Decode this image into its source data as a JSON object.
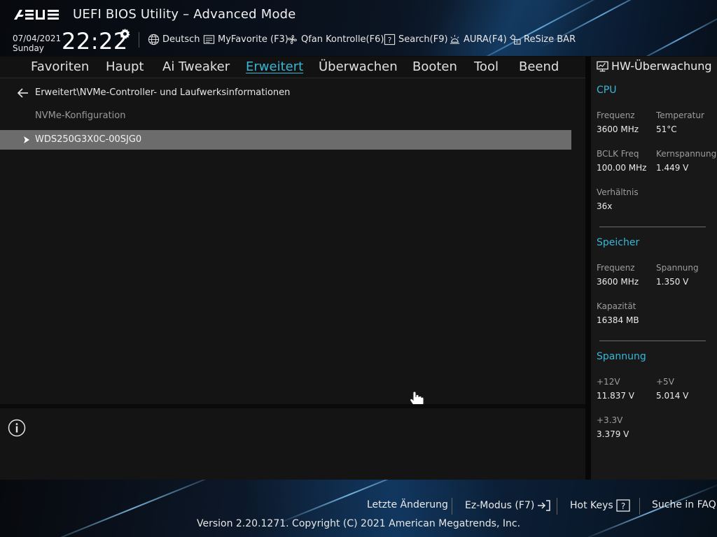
{
  "header": {
    "logo_text": "ASUS",
    "title": "UEFI BIOS Utility – Advanced Mode",
    "date": "07/04/2021",
    "day": "Sunday",
    "time": "22:22",
    "toolbar": [
      {
        "label": "Deutsch",
        "icon": "globe-icon"
      },
      {
        "label": "MyFavorite (F3)",
        "icon": "favorite-list-icon"
      },
      {
        "label": "Qfan Kontrolle(F6)",
        "icon": "fan-icon"
      },
      {
        "label": "Search(F9)",
        "icon": "search-help-icon"
      },
      {
        "label": "AURA(F4)",
        "icon": "aura-light-icon"
      },
      {
        "label": "ReSize BAR",
        "icon": "resize-bar-icon"
      }
    ]
  },
  "nav": {
    "tabs": [
      "Favoriten",
      "Haupt",
      "Ai Tweaker",
      "Erweitert",
      "Überwachen",
      "Booten",
      "Tool",
      "Beend"
    ],
    "active": "Erweitert"
  },
  "main": {
    "breadcrumb": "Erweitert\\NVMe-Controller- und Laufwerksinformationen",
    "section_label": "NVMe-Konfiguration",
    "items": [
      {
        "label": "WDS250G3X0C-00SJG0"
      }
    ]
  },
  "monitor": {
    "title": "HW-Überwachung",
    "cpu": {
      "title": "CPU",
      "freq_label": "Frequenz",
      "freq_value": "3600 MHz",
      "temp_label": "Temperatur",
      "temp_value": "51°C",
      "bclk_label": "BCLK Freq",
      "bclk_value": "100.00 MHz",
      "core_v_label": "Kernspannung",
      "core_v_value": "1.449 V",
      "ratio_label": "Verhältnis",
      "ratio_value": "36x"
    },
    "memory": {
      "title": "Speicher",
      "freq_label": "Frequenz",
      "freq_value": "3600 MHz",
      "volt_label": "Spannung",
      "volt_value": "1.350 V",
      "cap_label": "Kapazität",
      "cap_value": "16384 MB"
    },
    "voltage": {
      "title": "Spannung",
      "v12_label": "+12V",
      "v12_value": "11.837 V",
      "v5_label": "+5V",
      "v5_value": "5.014 V",
      "v33_label": "+3.3V",
      "v33_value": "3.379 V"
    }
  },
  "footer": {
    "last_change": "Letzte Änderung",
    "ez_mode": "Ez-Modus (F7)",
    "hot_keys": "Hot Keys",
    "faq": "Suche in FAQ",
    "copyright": "Version 2.20.1271. Copyright (C) 2021 American Megatrends, Inc."
  },
  "colors": {
    "accent": "#36b8d8",
    "selected_row": "#6c6c6c",
    "panel_bg": "#141414"
  }
}
